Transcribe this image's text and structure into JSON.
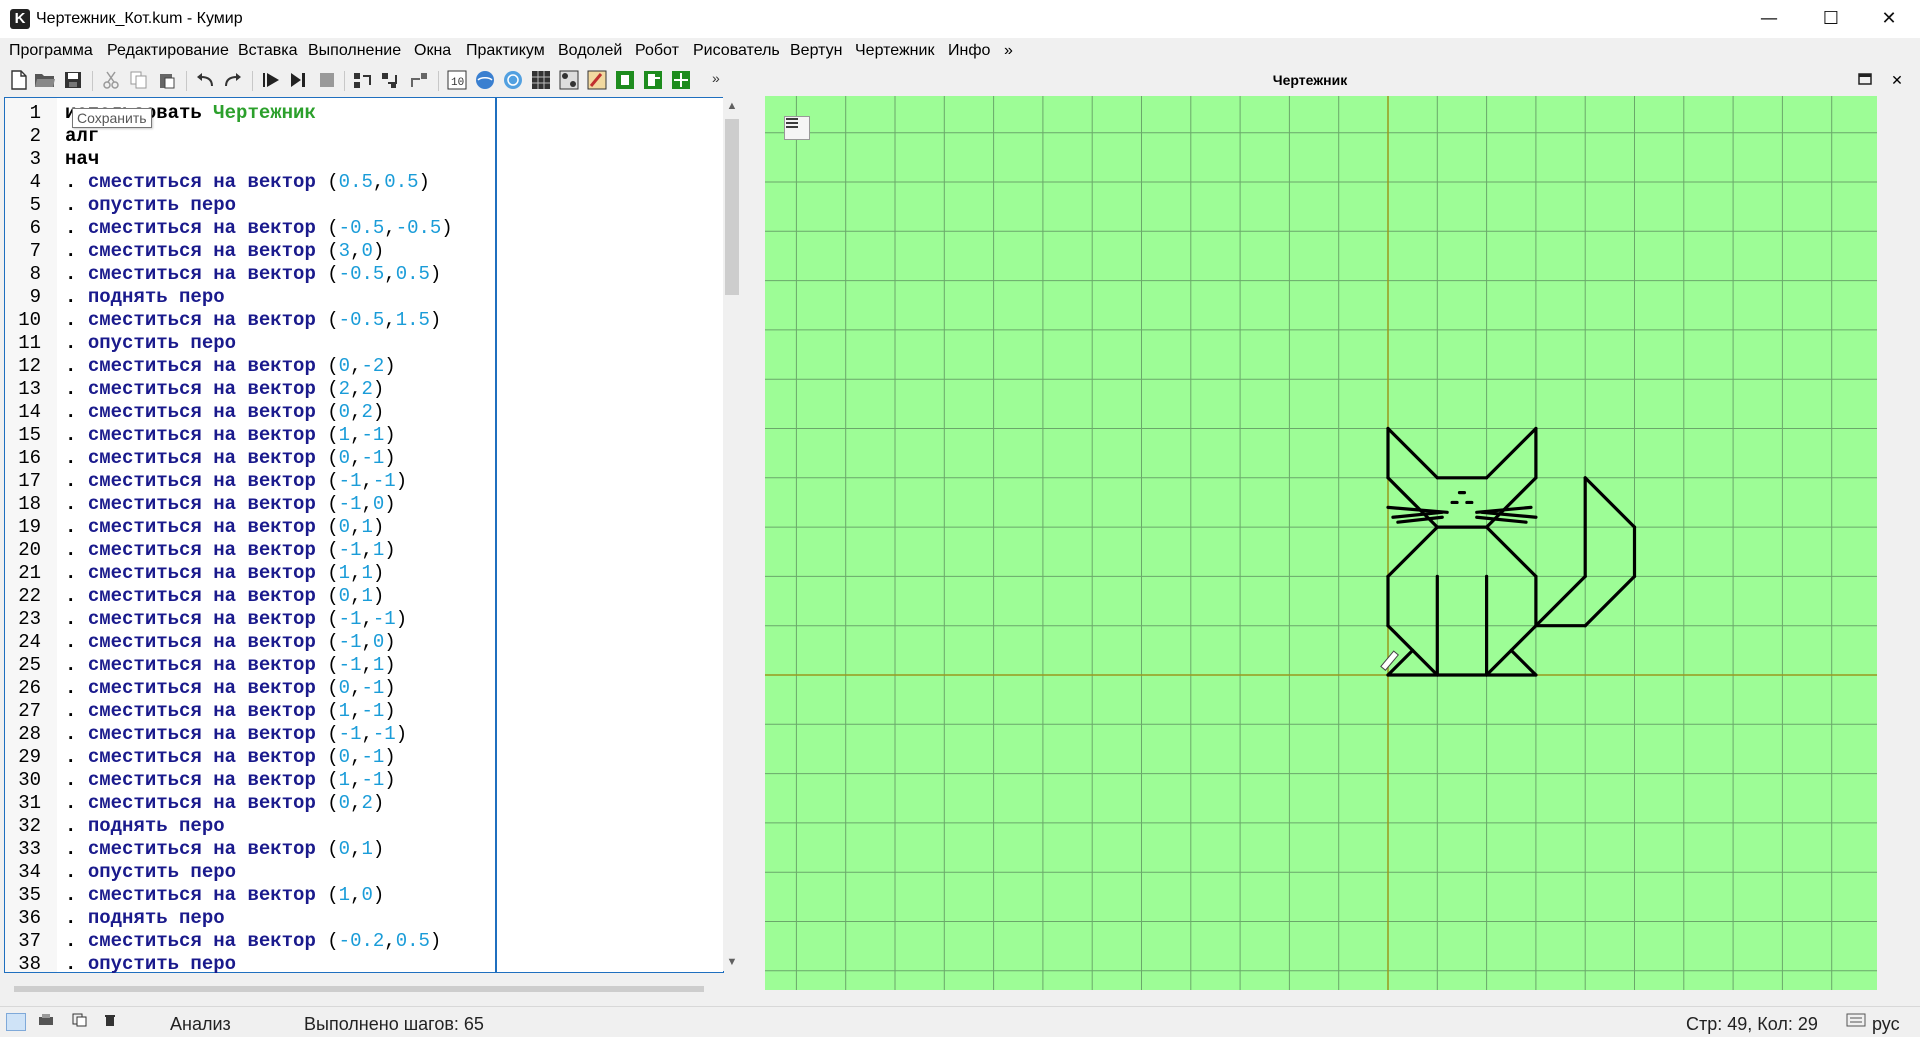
{
  "window": {
    "title": "Чертежник_Кот.kum - Кумир",
    "icon_letter": "K",
    "minimize": "—",
    "maximize": "☐",
    "close": "✕"
  },
  "menu": [
    "Программа",
    "Редактирование",
    "Вставка",
    "Выполнение",
    "Окна",
    "Практикум",
    "Водолей",
    "Робот",
    "Рисователь",
    "Вертун",
    "Чертежник",
    "Инфо",
    "»"
  ],
  "toolbar": {
    "more": "»",
    "tooltip": "Сохранить",
    "buttons": [
      "new-file-icon",
      "open-file-icon",
      "save-icon",
      "cut-icon",
      "copy-icon",
      "paste-icon",
      "undo-icon",
      "redo-icon",
      "run-icon",
      "run-step-icon",
      "stop-icon",
      "step-over-icon",
      "step-in-icon",
      "step-out-icon",
      "variables-icon",
      "robot-icon",
      "drawer-icon",
      "grid-icon",
      "palette-icon",
      "painter-icon",
      "vodoley-icon",
      "turtle-icon",
      "chertezhnik-icon"
    ]
  },
  "editor": {
    "lines": [
      {
        "n": "1",
        "t": "использовать Чертежник"
      },
      {
        "n": "2",
        "t": "алг"
      },
      {
        "n": "3",
        "t": "нач"
      },
      {
        "n": "4",
        "t": ". сместиться на вектор (0.5,0.5)"
      },
      {
        "n": "5",
        "t": ". опустить перо"
      },
      {
        "n": "6",
        "t": ". сместиться на вектор (-0.5,-0.5)"
      },
      {
        "n": "7",
        "t": ". сместиться на вектор (3,0)"
      },
      {
        "n": "8",
        "t": ". сместиться на вектор (-0.5,0.5)"
      },
      {
        "n": "9",
        "t": ". поднять перо"
      },
      {
        "n": "10",
        "t": ". сместиться на вектор (-0.5,1.5)"
      },
      {
        "n": "11",
        "t": ". опустить перо"
      },
      {
        "n": "12",
        "t": ". сместиться на вектор (0,-2)"
      },
      {
        "n": "13",
        "t": ". сместиться на вектор (2,2)"
      },
      {
        "n": "14",
        "t": ". сместиться на вектор (0,2)"
      },
      {
        "n": "15",
        "t": ". сместиться на вектор (1,-1)"
      },
      {
        "n": "16",
        "t": ". сместиться на вектор (0,-1)"
      },
      {
        "n": "17",
        "t": ". сместиться на вектор (-1,-1)"
      },
      {
        "n": "18",
        "t": ". сместиться на вектор (-1,0)"
      },
      {
        "n": "19",
        "t": ". сместиться на вектор (0,1)"
      },
      {
        "n": "20",
        "t": ". сместиться на вектор (-1,1)"
      },
      {
        "n": "21",
        "t": ". сместиться на вектор (1,1)"
      },
      {
        "n": "22",
        "t": ". сместиться на вектор (0,1)"
      },
      {
        "n": "23",
        "t": ". сместиться на вектор (-1,-1)"
      },
      {
        "n": "24",
        "t": ". сместиться на вектор (-1,0)"
      },
      {
        "n": "25",
        "t": ". сместиться на вектор (-1,1)"
      },
      {
        "n": "26",
        "t": ". сместиться на вектор (0,-1)"
      },
      {
        "n": "27",
        "t": ". сместиться на вектор (1,-1)"
      },
      {
        "n": "28",
        "t": ". сместиться на вектор (-1,-1)"
      },
      {
        "n": "29",
        "t": ". сместиться на вектор (0,-1)"
      },
      {
        "n": "30",
        "t": ". сместиться на вектор (1,-1)"
      },
      {
        "n": "31",
        "t": ". сместиться на вектор (0,2)"
      },
      {
        "n": "32",
        "t": ". поднять перо"
      },
      {
        "n": "33",
        "t": ". сместиться на вектор (0,1)"
      },
      {
        "n": "34",
        "t": ". опустить перо"
      },
      {
        "n": "35",
        "t": ". сместиться на вектор (1,0)"
      },
      {
        "n": "36",
        "t": ". поднять перо"
      },
      {
        "n": "37",
        "t": ". сместиться на вектор (-0.2,0.5)"
      },
      {
        "n": "38",
        "t": ". опустить перо"
      }
    ],
    "colors": {
      "keyword": "#000000",
      "command": "#1a1a8c",
      "number": "#1a9cd8",
      "module": "#2ca02c"
    }
  },
  "drawer": {
    "title": "Чертежник",
    "canvas_color": "#9dfd96",
    "grid_color": "#6aa86a",
    "axis_color": "#9a9a1e"
  },
  "status": {
    "mode": "Анализ",
    "steps": "Выполнено шагов: 65",
    "position": "Стр: 49, Кол: 29",
    "lang": "рус"
  }
}
